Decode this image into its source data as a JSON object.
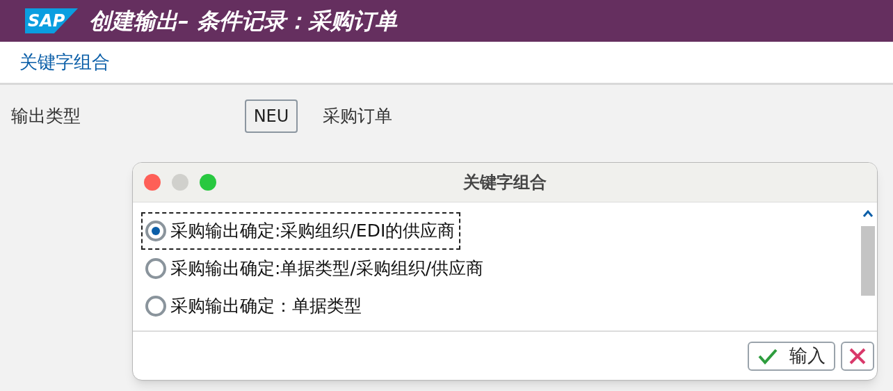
{
  "header": {
    "logo": "SAP",
    "title": "创建输出– 条件记录：采购订单"
  },
  "toolbar": {
    "link": "关键字组合"
  },
  "form": {
    "label": "输出类型",
    "value": "NEU",
    "description": "采购订单"
  },
  "dialog": {
    "title": "关键字组合",
    "options": [
      {
        "label": "采购输出确定:采购组织/EDI的供应商",
        "selected": true
      },
      {
        "label": "采购输出确定:单据类型/采购组织/供应商",
        "selected": false
      },
      {
        "label": "采购输出确定：单据类型",
        "selected": false
      }
    ],
    "buttons": [
      {
        "kind": "confirm",
        "label": "输入"
      },
      {
        "kind": "cancel"
      }
    ]
  }
}
